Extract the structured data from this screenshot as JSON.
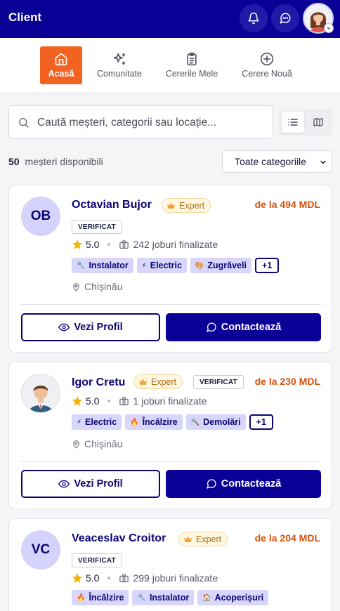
{
  "app": {
    "title": "Client"
  },
  "nav": {
    "items": [
      {
        "label": "Acasă",
        "icon": "home-icon",
        "active": true
      },
      {
        "label": "Comunitate",
        "icon": "sparkles-icon"
      },
      {
        "label": "Cererile Mele",
        "icon": "clipboard-icon"
      },
      {
        "label": "Cerere Nouă",
        "icon": "plus-circle-icon"
      }
    ]
  },
  "search": {
    "placeholder": "Caută meșteri, categorii sau locație..."
  },
  "results": {
    "count": "50",
    "label": "meșteri disponibili"
  },
  "filter": {
    "selected": "Toate categoriile"
  },
  "colors": {
    "primary": "#0a0096",
    "accent": "#f26322",
    "price": "#d4520d",
    "tag_bg": "#d8d6fb"
  },
  "cards": [
    {
      "initials": "OB",
      "name": "Octavian Bujor",
      "expert": "Expert",
      "verified": "VERIFICAT",
      "price": "de la 494 MDL",
      "rating": "5.0",
      "jobs": "242 joburi finalizate",
      "tags": [
        {
          "icon": "wrench-icon",
          "label": "Instalator"
        },
        {
          "icon": "lightning-icon",
          "label": "Electric"
        },
        {
          "icon": "paint-icon",
          "label": "Zugrăveli"
        }
      ],
      "more": "+1",
      "location": "Chișinău",
      "profile_label": "Vezi Profil",
      "contact_label": "Contactează"
    },
    {
      "initials": "",
      "name": "Igor Cretu",
      "expert": "Expert",
      "verified": "VERIFICAT",
      "price": "de la 230 MDL",
      "rating": "5.0",
      "jobs": "1 joburi finalizate",
      "tags": [
        {
          "icon": "lightning-icon",
          "label": "Electric"
        },
        {
          "icon": "fire-icon",
          "label": "Încălzire"
        },
        {
          "icon": "hammer-icon",
          "label": "Demolări"
        }
      ],
      "more": "+1",
      "location": "Chișinău",
      "profile_label": "Vezi Profil",
      "contact_label": "Contactează"
    },
    {
      "initials": "VC",
      "name": "Veaceslav Croitor",
      "expert": "Expert",
      "verified": "VERIFICAT",
      "price": "de la 204 MDL",
      "rating": "5.0",
      "jobs": "299 joburi finalizate",
      "tags": [
        {
          "icon": "fire-icon",
          "label": "Încălzire"
        },
        {
          "icon": "wrench-icon",
          "label": "Instalator"
        },
        {
          "icon": "house-icon",
          "label": "Acoperișuri"
        }
      ]
    }
  ]
}
